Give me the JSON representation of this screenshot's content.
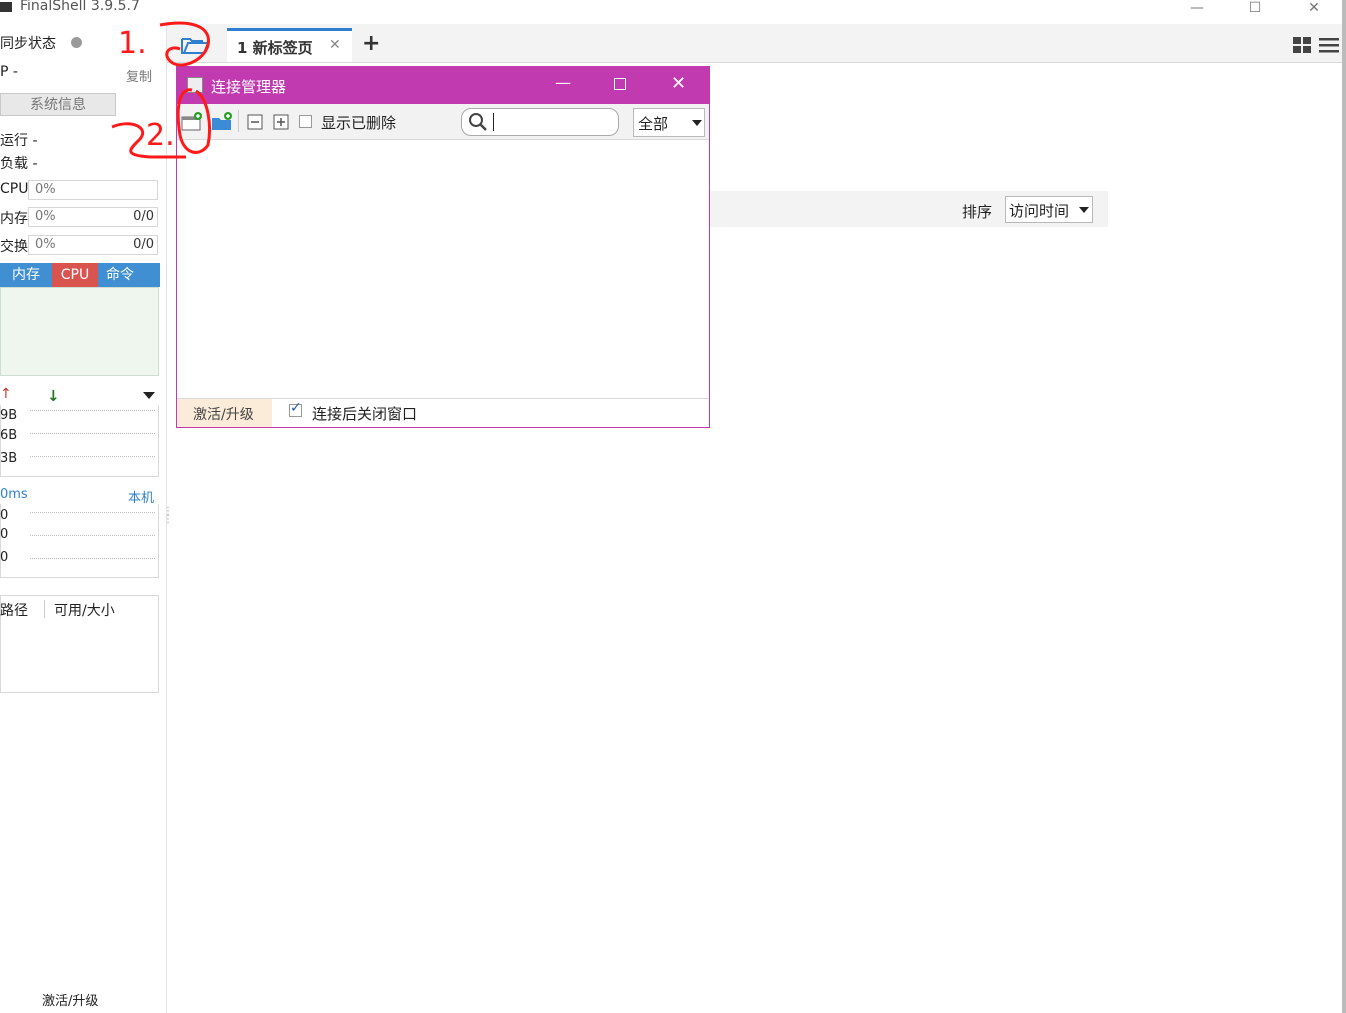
{
  "window": {
    "title": "FinalShell 3.9.5.7",
    "controls": {
      "minimize": "—",
      "maximize": "☐",
      "close": "✕"
    }
  },
  "sidebar": {
    "sync_status_label": "同步状态",
    "ip_label": "P -",
    "copy_label": "复制",
    "sysinfo_button": "系统信息",
    "uptime_label": "运行 -",
    "load_label": "负载 -",
    "cpu_label": "CPU",
    "cpu_value": "0%",
    "mem_label": "内存",
    "mem_value": "0%",
    "mem_ratio": "0/0",
    "swap_label": "交换",
    "swap_value": "0%",
    "swap_ratio": "0/0",
    "monitor_tabs": [
      "内存",
      "CPU",
      "命令"
    ],
    "net_ticks": [
      "9B",
      "6B",
      "3B"
    ],
    "latency_label": "0ms",
    "latency_host": "本机",
    "latency_ticks": [
      "0",
      "0",
      "0"
    ],
    "disk_columns": [
      "路径",
      "可用/大小"
    ],
    "footer_activate": "激活/升级"
  },
  "tabs": {
    "active_tab": "1 新标签页",
    "add_label": "+"
  },
  "main": {
    "sort_label": "排序",
    "sort_value": "访问时间"
  },
  "dialog": {
    "title": "连接管理器",
    "show_deleted_label": "显示已删除",
    "filter_value": "全部",
    "footer_activate": "激活/升级",
    "close_after_connect_label": "连接后关闭窗口",
    "close_after_connect_checked": true
  },
  "annotations": [
    "1.",
    "2."
  ],
  "colors": {
    "dialog_accent": "#c13ab0",
    "tab_accent": "#2f7fd0",
    "monitor_tab_bg": "#3f8fd2",
    "cpu_tab_bg": "#d9534f",
    "annotation_red": "#ff1a1a"
  }
}
